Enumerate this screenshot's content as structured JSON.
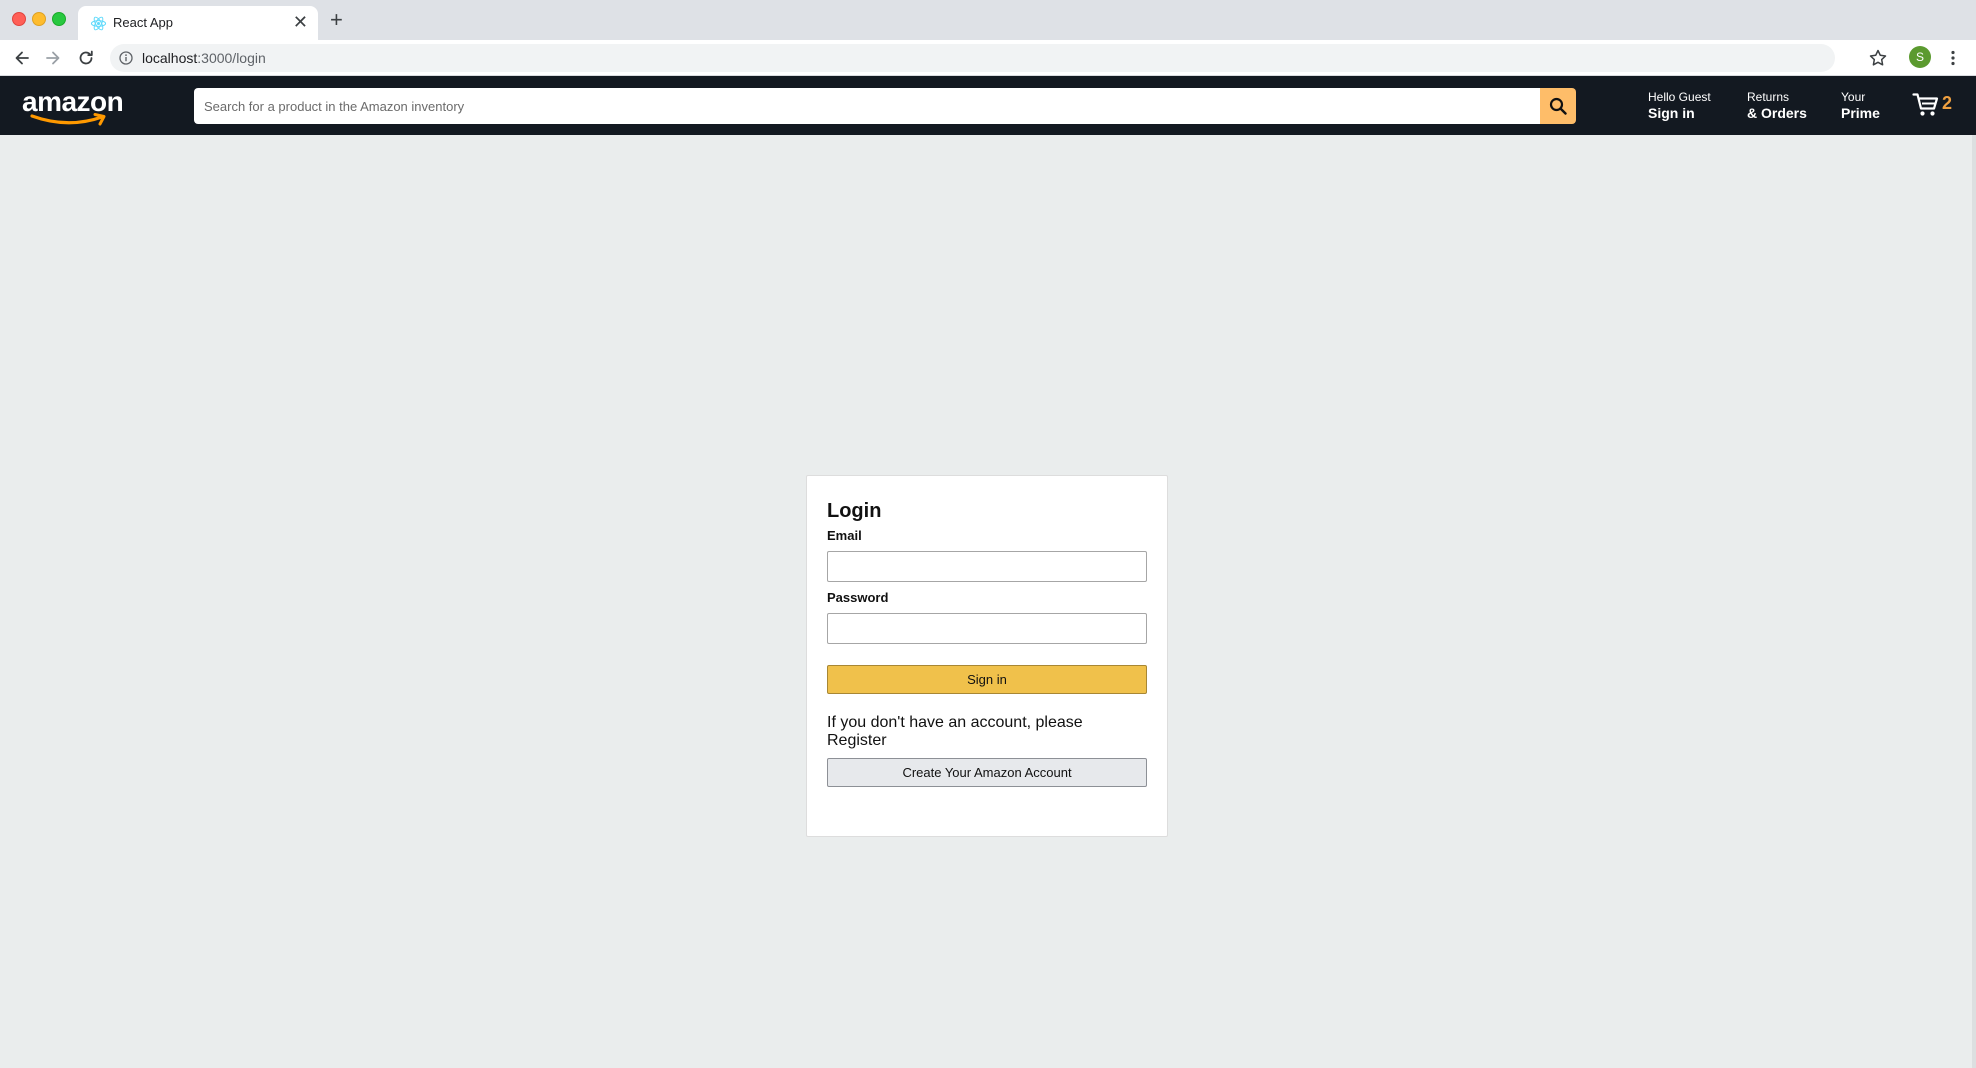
{
  "browser": {
    "tab_title": "React App",
    "tab_close": "✕",
    "new_tab": "+",
    "url_host": "localhost",
    "url_path": ":3000/login",
    "profile_initial": "S"
  },
  "header": {
    "logo": "amazon",
    "search_placeholder": "Search for a product in the Amazon inventory",
    "account": {
      "line1": "Hello Guest",
      "line2": "Sign in"
    },
    "orders": {
      "line1": "Returns",
      "line2": "& Orders"
    },
    "prime": {
      "line1": "Your",
      "line2": "Prime"
    },
    "basket_count": "2"
  },
  "login": {
    "title": "Login",
    "email_label": "Email",
    "email_value": "",
    "password_label": "Password",
    "password_value": "",
    "signin_label": "Sign in",
    "register_note": "If you don't have an account, please Register",
    "create_label": "Create Your Amazon Account"
  },
  "colors": {
    "header_bg": "#131921",
    "page_bg": "#eaeded",
    "search_button": "#febd69",
    "signin_button": "#f0c14b",
    "basket_count": "#f0a040"
  },
  "icons": [
    "react-favicon-icon",
    "info-icon",
    "back-arrow-icon",
    "forward-arrow-icon",
    "reload-icon",
    "star-icon",
    "kebab-menu-icon",
    "search-icon",
    "cart-icon"
  ]
}
